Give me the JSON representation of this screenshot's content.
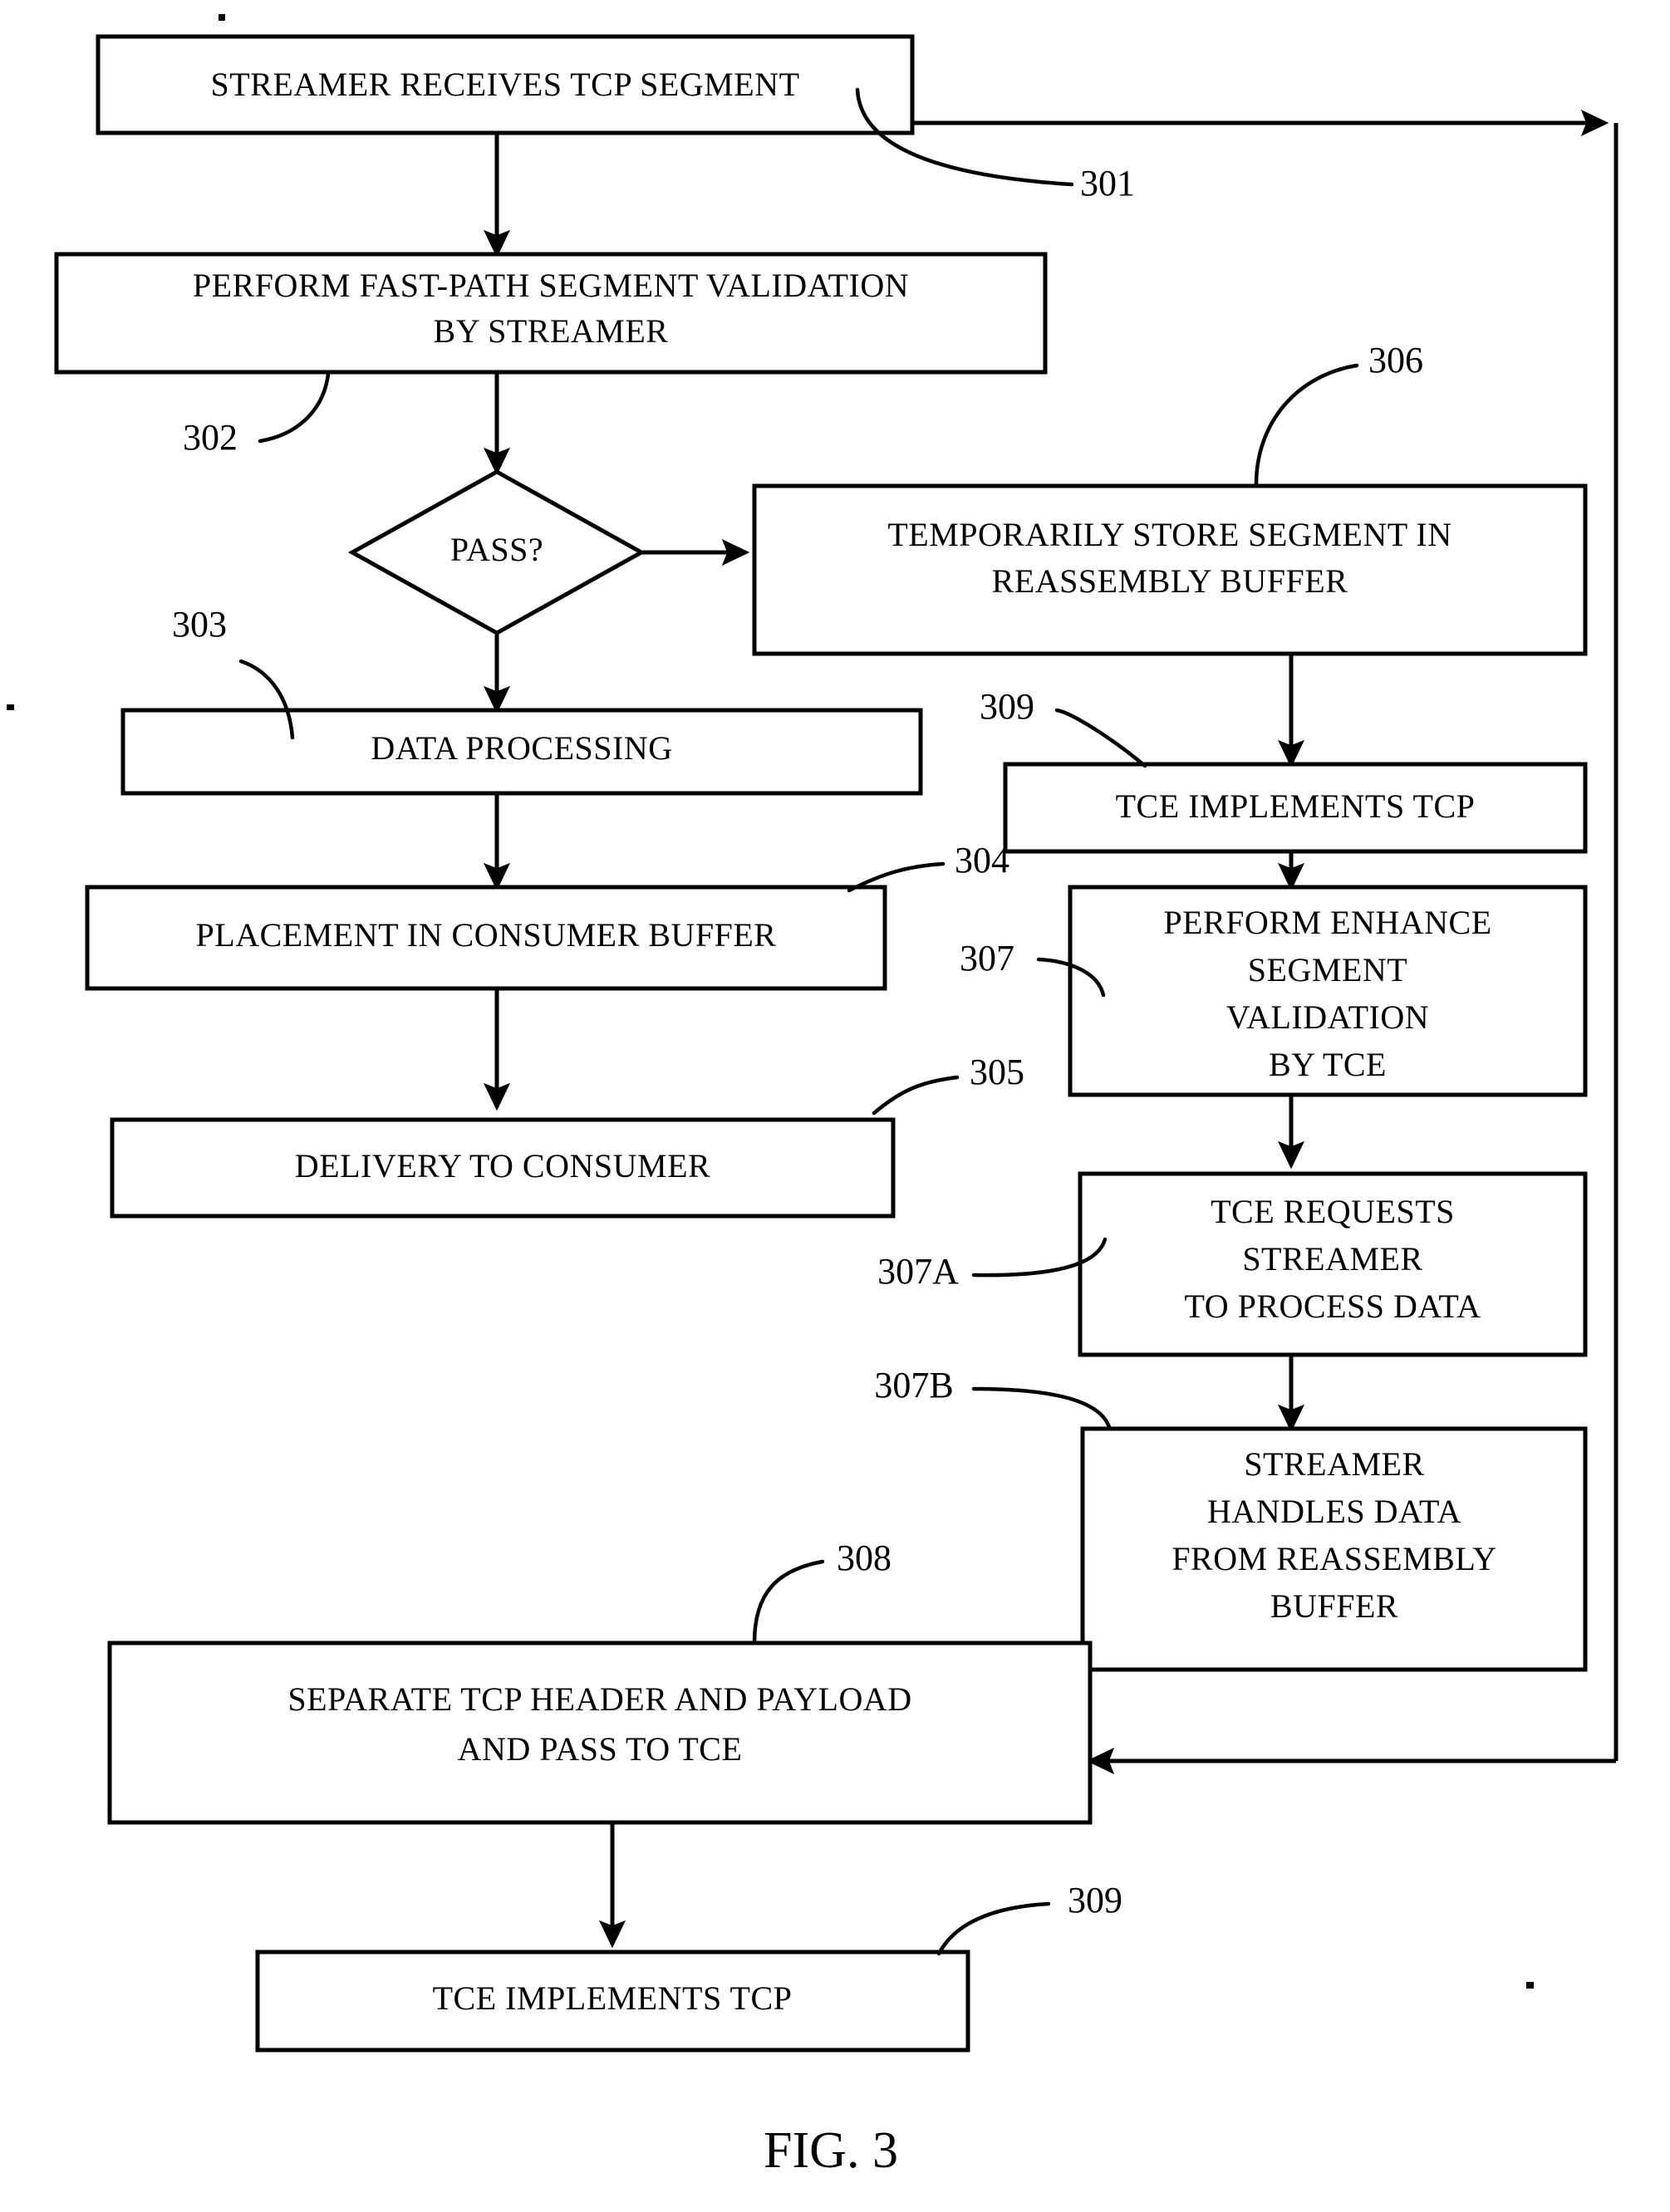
{
  "figure": {
    "caption": "FIG. 3",
    "title": "TCP segment processing flowchart"
  },
  "nodes": [
    {
      "id": "301",
      "ref": "301",
      "shape": "rect",
      "lines": [
        "STREAMER RECEIVES TCP SEGMENT"
      ]
    },
    {
      "id": "302",
      "ref": "302",
      "shape": "rect",
      "lines": [
        "PERFORM FAST-PATH SEGMENT VALIDATION",
        "BY STREAMER"
      ]
    },
    {
      "id": "pass",
      "ref": "",
      "shape": "diamond",
      "lines": [
        "PASS?"
      ]
    },
    {
      "id": "303",
      "ref": "303",
      "shape": "rect",
      "lines": [
        "DATA PROCESSING"
      ]
    },
    {
      "id": "304",
      "ref": "304",
      "shape": "rect",
      "lines": [
        "PLACEMENT IN CONSUMER BUFFER"
      ]
    },
    {
      "id": "305",
      "ref": "305",
      "shape": "rect",
      "lines": [
        "DELIVERY TO CONSUMER"
      ]
    },
    {
      "id": "306",
      "ref": "306",
      "shape": "rect",
      "lines": [
        "TEMPORARILY STORE SEGMENT IN",
        "REASSEMBLY BUFFER"
      ]
    },
    {
      "id": "309a",
      "ref": "309",
      "shape": "rect",
      "lines": [
        "TCE IMPLEMENTS TCP"
      ]
    },
    {
      "id": "307",
      "ref": "307",
      "shape": "rect",
      "lines": [
        "PERFORM ENHANCE",
        "SEGMENT",
        "VALIDATION",
        "BY TCE"
      ]
    },
    {
      "id": "307A",
      "ref": "307A",
      "shape": "rect",
      "lines": [
        "TCE REQUESTS",
        "STREAMER",
        "TO PROCESS DATA"
      ]
    },
    {
      "id": "307B",
      "ref": "307B",
      "shape": "rect",
      "lines": [
        "STREAMER",
        "HANDLES DATA",
        "FROM REASSEMBLY",
        "BUFFER"
      ]
    },
    {
      "id": "308",
      "ref": "308",
      "shape": "rect",
      "lines": [
        "SEPARATE TCP HEADER AND PAYLOAD",
        "AND PASS TO TCE"
      ]
    },
    {
      "id": "309b",
      "ref": "309",
      "shape": "rect",
      "lines": [
        "TCE IMPLEMENTS TCP"
      ]
    }
  ],
  "text": {
    "n301_l1": "STREAMER RECEIVES TCP SEGMENT",
    "n302_l1": "PERFORM FAST-PATH SEGMENT VALIDATION",
    "n302_l2": "BY STREAMER",
    "pass_l1": "PASS?",
    "n303_l1": "DATA PROCESSING",
    "n304_l1": "PLACEMENT IN CONSUMER BUFFER",
    "n305_l1": "DELIVERY TO CONSUMER",
    "n306_l1": "TEMPORARILY STORE SEGMENT IN",
    "n306_l2": "REASSEMBLY BUFFER",
    "n309a_l1": "TCE IMPLEMENTS TCP",
    "n307_l1": "PERFORM ENHANCE",
    "n307_l2": "SEGMENT",
    "n307_l3": "VALIDATION",
    "n307_l4": "BY TCE",
    "n307A_l1": "TCE REQUESTS",
    "n307A_l2": "STREAMER",
    "n307A_l3": "TO PROCESS DATA",
    "n307B_l1": "STREAMER",
    "n307B_l2": "HANDLES DATA",
    "n307B_l3": "FROM REASSEMBLY",
    "n307B_l4": "BUFFER",
    "n308_l1": "SEPARATE TCP HEADER AND PAYLOAD",
    "n308_l2": "AND PASS TO TCE",
    "n309b_l1": "TCE IMPLEMENTS TCP"
  },
  "refs": {
    "r301": "301",
    "r302": "302",
    "r303": "303",
    "r304": "304",
    "r305": "305",
    "r306": "306",
    "r307": "307",
    "r307A": "307A",
    "r307B": "307B",
    "r308": "308",
    "r309_top": "309",
    "r309_bottom": "309"
  },
  "colors": {
    "stroke": "#000000",
    "fill": "#ffffff",
    "background": "#ffffff"
  }
}
